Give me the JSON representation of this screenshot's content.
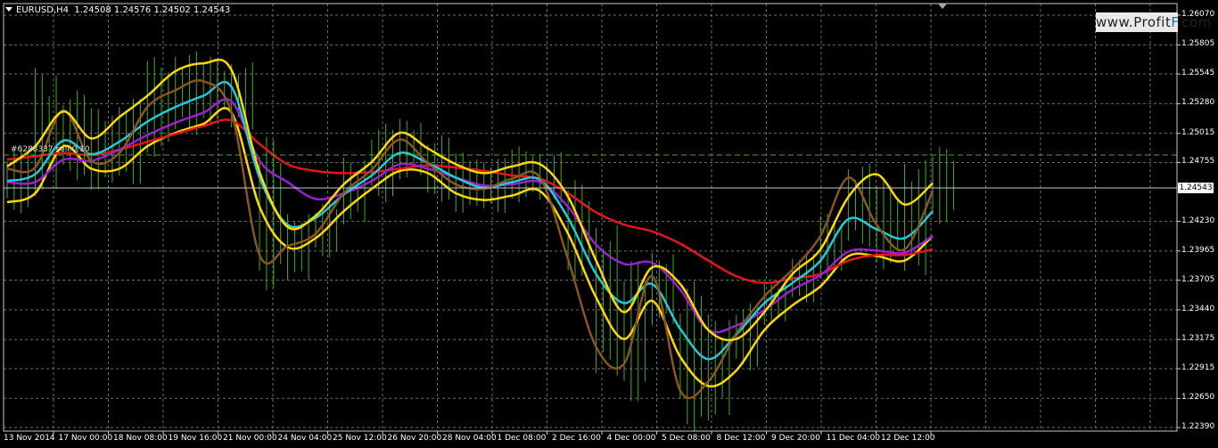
{
  "header": {
    "symbol": "EURUSD,H4",
    "ohlc": "1.24508 1.24576 1.24502 1.24543"
  },
  "watermark": {
    "prefix": "www.Profit",
    "highlight": "F",
    "suffix": ".com"
  },
  "order_label": "#6288337 sell 0.10",
  "current_price": "1.24543",
  "colors": {
    "background": "#000000",
    "grid": "#6b6b6b",
    "axis": "#c8c8c8",
    "bars": "#3fb01f",
    "ma_red": "#e8141b",
    "ma_purple": "#9a1fd6",
    "ma_cyan": "#22c9d8",
    "envelope_yellow": "#ffd800",
    "price_brown": "#8a5520"
  },
  "chart_data": {
    "type": "line",
    "title": "EURUSD,H4",
    "xlabel": "",
    "ylabel": "",
    "ylim": [
      1.2239,
      1.2607
    ],
    "grid": true,
    "y_ticks": [
      "1.26070",
      "1.25805",
      "1.25545",
      "1.25280",
      "1.25015",
      "1.24755",
      "1.24230",
      "1.23965",
      "1.23705",
      "1.23440",
      "1.23175",
      "1.22915",
      "1.22650",
      "1.22390"
    ],
    "x_ticks": [
      "13 Nov 2014",
      "17 Nov 00:00",
      "18 Nov 08:00",
      "19 Nov 16:00",
      "21 Nov 00:00",
      "24 Nov 04:00",
      "25 Nov 12:00",
      "26 Nov 20:00",
      "28 Nov 04:00",
      "1 Dec 08:00",
      "2 Dec 16:00",
      "4 Dec 00:00",
      "5 Dec 08:00",
      "8 Dec 12:00",
      "9 Dec 20:00",
      "11 Dec 04:00",
      "12 Dec 12:00"
    ],
    "x_index": [
      0,
      1,
      2,
      3,
      4,
      5,
      6,
      7,
      8,
      9,
      10,
      11,
      12,
      13,
      14,
      15,
      16,
      17,
      18,
      19,
      20,
      21,
      22,
      23,
      24,
      25,
      26,
      27,
      28,
      29,
      30,
      31,
      32,
      33
    ],
    "series": [
      {
        "color": "#ffd800",
        "values": [
          1.2472,
          1.249,
          1.2521,
          1.2497,
          1.2516,
          1.2535,
          1.2557,
          1.2564,
          1.2558,
          1.2467,
          1.2418,
          1.2428,
          1.2456,
          1.2476,
          1.2502,
          1.2488,
          1.2474,
          1.2466,
          1.2472,
          1.2474,
          1.2445,
          1.2388,
          1.2342,
          1.2382,
          1.2367,
          1.2326,
          1.2318,
          1.2342,
          1.2376,
          1.2398,
          1.2445,
          1.2465,
          1.2438,
          1.2457
        ]
      },
      {
        "color": "#8a5520",
        "values": [
          1.247,
          1.2471,
          1.2522,
          1.2477,
          1.2484,
          1.2525,
          1.254,
          1.2548,
          1.252,
          1.2393,
          1.2401,
          1.2412,
          1.2448,
          1.2469,
          1.2496,
          1.2475,
          1.2456,
          1.2452,
          1.2461,
          1.2462,
          1.2389,
          1.2311,
          1.2296,
          1.2374,
          1.2272,
          1.228,
          1.2323,
          1.2356,
          1.238,
          1.241,
          1.2462,
          1.242,
          1.2398,
          1.245
        ]
      },
      {
        "color": "#22c9d8",
        "values": [
          1.2459,
          1.2465,
          1.2495,
          1.2483,
          1.2494,
          1.2512,
          1.2525,
          1.2535,
          1.2543,
          1.2462,
          1.242,
          1.2426,
          1.2447,
          1.2464,
          1.2484,
          1.2475,
          1.2462,
          1.2453,
          1.2458,
          1.246,
          1.2426,
          1.2376,
          1.235,
          1.2367,
          1.2327,
          1.23,
          1.2322,
          1.235,
          1.2368,
          1.2388,
          1.2425,
          1.2416,
          1.2408,
          1.2432
        ]
      },
      {
        "color": "#9a1fd6",
        "values": [
          1.2458,
          1.2458,
          1.2478,
          1.2477,
          1.2487,
          1.25,
          1.2511,
          1.252,
          1.253,
          1.2477,
          1.2458,
          1.2443,
          1.2448,
          1.2459,
          1.2474,
          1.247,
          1.2462,
          1.2455,
          1.2456,
          1.2458,
          1.2436,
          1.2402,
          1.2385,
          1.2386,
          1.2362,
          1.2326,
          1.233,
          1.2344,
          1.2362,
          1.2375,
          1.2396,
          1.2397,
          1.2395,
          1.241
        ]
      },
      {
        "color": "#e8141b",
        "values": [
          1.2478,
          1.2481,
          1.2484,
          1.2482,
          1.2487,
          1.2494,
          1.2501,
          1.2508,
          1.2513,
          1.2492,
          1.2474,
          1.2468,
          1.2466,
          1.2467,
          1.247,
          1.2473,
          1.2471,
          1.2468,
          1.2464,
          1.2461,
          1.2448,
          1.2431,
          1.242,
          1.2414,
          1.2403,
          1.2388,
          1.2374,
          1.2368,
          1.2372,
          1.2376,
          1.2388,
          1.2393,
          1.2393,
          1.2398
        ]
      },
      {
        "color": "#ffd800",
        "values": [
          1.244,
          1.2448,
          1.249,
          1.247,
          1.247,
          1.249,
          1.2502,
          1.251,
          1.252,
          1.2436,
          1.24,
          1.2408,
          1.2432,
          1.2452,
          1.2468,
          1.2466,
          1.2448,
          1.2442,
          1.2446,
          1.245,
          1.2412,
          1.2355,
          1.2318,
          1.2352,
          1.2302,
          1.2276,
          1.229,
          1.2326,
          1.2348,
          1.2365,
          1.2392,
          1.2392,
          1.2388,
          1.241
        ]
      }
    ],
    "bars": {
      "color": "#3fb01f",
      "high": [
        1.249,
        1.256,
        1.254,
        1.2525,
        1.2534,
        1.257,
        1.2575,
        1.257,
        1.2565,
        1.25,
        1.243,
        1.244,
        1.248,
        1.251,
        1.2515,
        1.25,
        1.2485,
        1.248,
        1.249,
        1.2485,
        1.246,
        1.242,
        1.239,
        1.2395,
        1.237,
        1.234,
        1.235,
        1.237,
        1.2395,
        1.243,
        1.2475,
        1.246,
        1.2478,
        1.249
      ],
      "low": [
        1.243,
        1.2445,
        1.246,
        1.245,
        1.2455,
        1.248,
        1.25,
        1.251,
        1.2505,
        1.236,
        1.237,
        1.239,
        1.242,
        1.244,
        1.246,
        1.244,
        1.243,
        1.243,
        1.244,
        1.244,
        1.237,
        1.2285,
        1.226,
        1.233,
        1.2235,
        1.2245,
        1.229,
        1.233,
        1.235,
        1.237,
        1.24,
        1.238,
        1.2375,
        1.242
      ]
    }
  }
}
